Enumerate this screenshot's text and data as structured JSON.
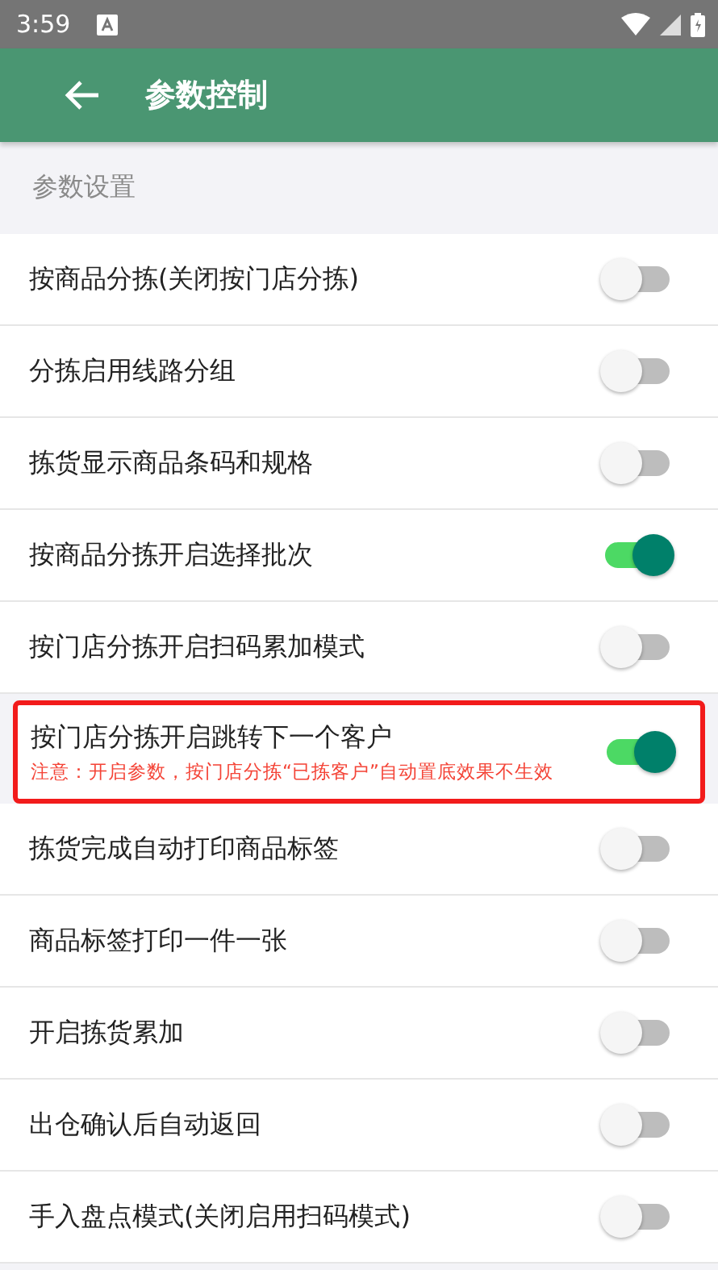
{
  "status_bar": {
    "time": "3:59"
  },
  "app_bar": {
    "title": "参数控制"
  },
  "section": {
    "title": "参数设置"
  },
  "settings": [
    {
      "label": "按商品分拣(关闭按门店分拣)",
      "on": false,
      "highlighted": false
    },
    {
      "label": "分拣启用线路分组",
      "on": false,
      "highlighted": false
    },
    {
      "label": "拣货显示商品条码和规格",
      "on": false,
      "highlighted": false
    },
    {
      "label": "按商品分拣开启选择批次",
      "on": true,
      "highlighted": false
    },
    {
      "label": "按门店分拣开启扫码累加模式",
      "on": false,
      "highlighted": false
    },
    {
      "label": "按门店分拣开启跳转下一个客户",
      "note": "注意：开启参数，按门店分拣“已拣客户”自动置底效果不生效",
      "on": true,
      "highlighted": true
    },
    {
      "label": "拣货完成自动打印商品标签",
      "on": false,
      "highlighted": false
    },
    {
      "label": "商品标签打印一件一张",
      "on": false,
      "highlighted": false
    },
    {
      "label": "开启拣货累加",
      "on": false,
      "highlighted": false
    },
    {
      "label": "出仓确认后自动返回",
      "on": false,
      "highlighted": false
    },
    {
      "label": "手入盘点模式(关闭启用扫码模式)",
      "on": false,
      "highlighted": false
    }
  ]
}
